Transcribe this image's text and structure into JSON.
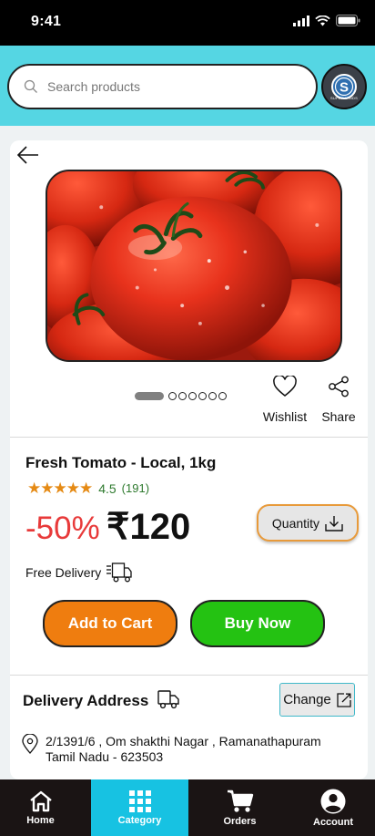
{
  "status_bar": {
    "time": "9:41"
  },
  "search": {
    "placeholder": "Search products",
    "logo_text": "SUPER MINDS"
  },
  "product": {
    "title": "Fresh Tomato - Local, 1kg",
    "stars": "★★★★★",
    "rating": "4.5",
    "rating_count": "(191)",
    "discount": "-50%",
    "price": "₹120",
    "free_delivery": "Free Delivery",
    "image_count": 7,
    "active_image": 1
  },
  "actions": {
    "wishlist": "Wishlist",
    "share": "Share",
    "quantity": "Quantity"
  },
  "buttons": {
    "add_to_cart": "Add to Cart",
    "buy_now": "Buy Now"
  },
  "delivery": {
    "title": "Delivery Address",
    "change": "Change",
    "address_line1": "2/1391/6 , Om shakthi Nagar , Ramanathapuram",
    "address_line2": "Tamil Nadu - 623503"
  },
  "nav": {
    "items": [
      {
        "label": "Home",
        "icon": "home-icon"
      },
      {
        "label": "Category",
        "icon": "grid-icon"
      },
      {
        "label": "Orders",
        "icon": "cart-icon"
      },
      {
        "label": "Account",
        "icon": "account-icon"
      }
    ],
    "active": "Category"
  },
  "colors": {
    "header_bg": "#55d6e3",
    "add_to_cart": "#ef7d0f",
    "buy_now": "#24c212",
    "discount": "#e83a3a",
    "nav_bg": "#1a1414",
    "nav_active": "#17c2e2"
  }
}
